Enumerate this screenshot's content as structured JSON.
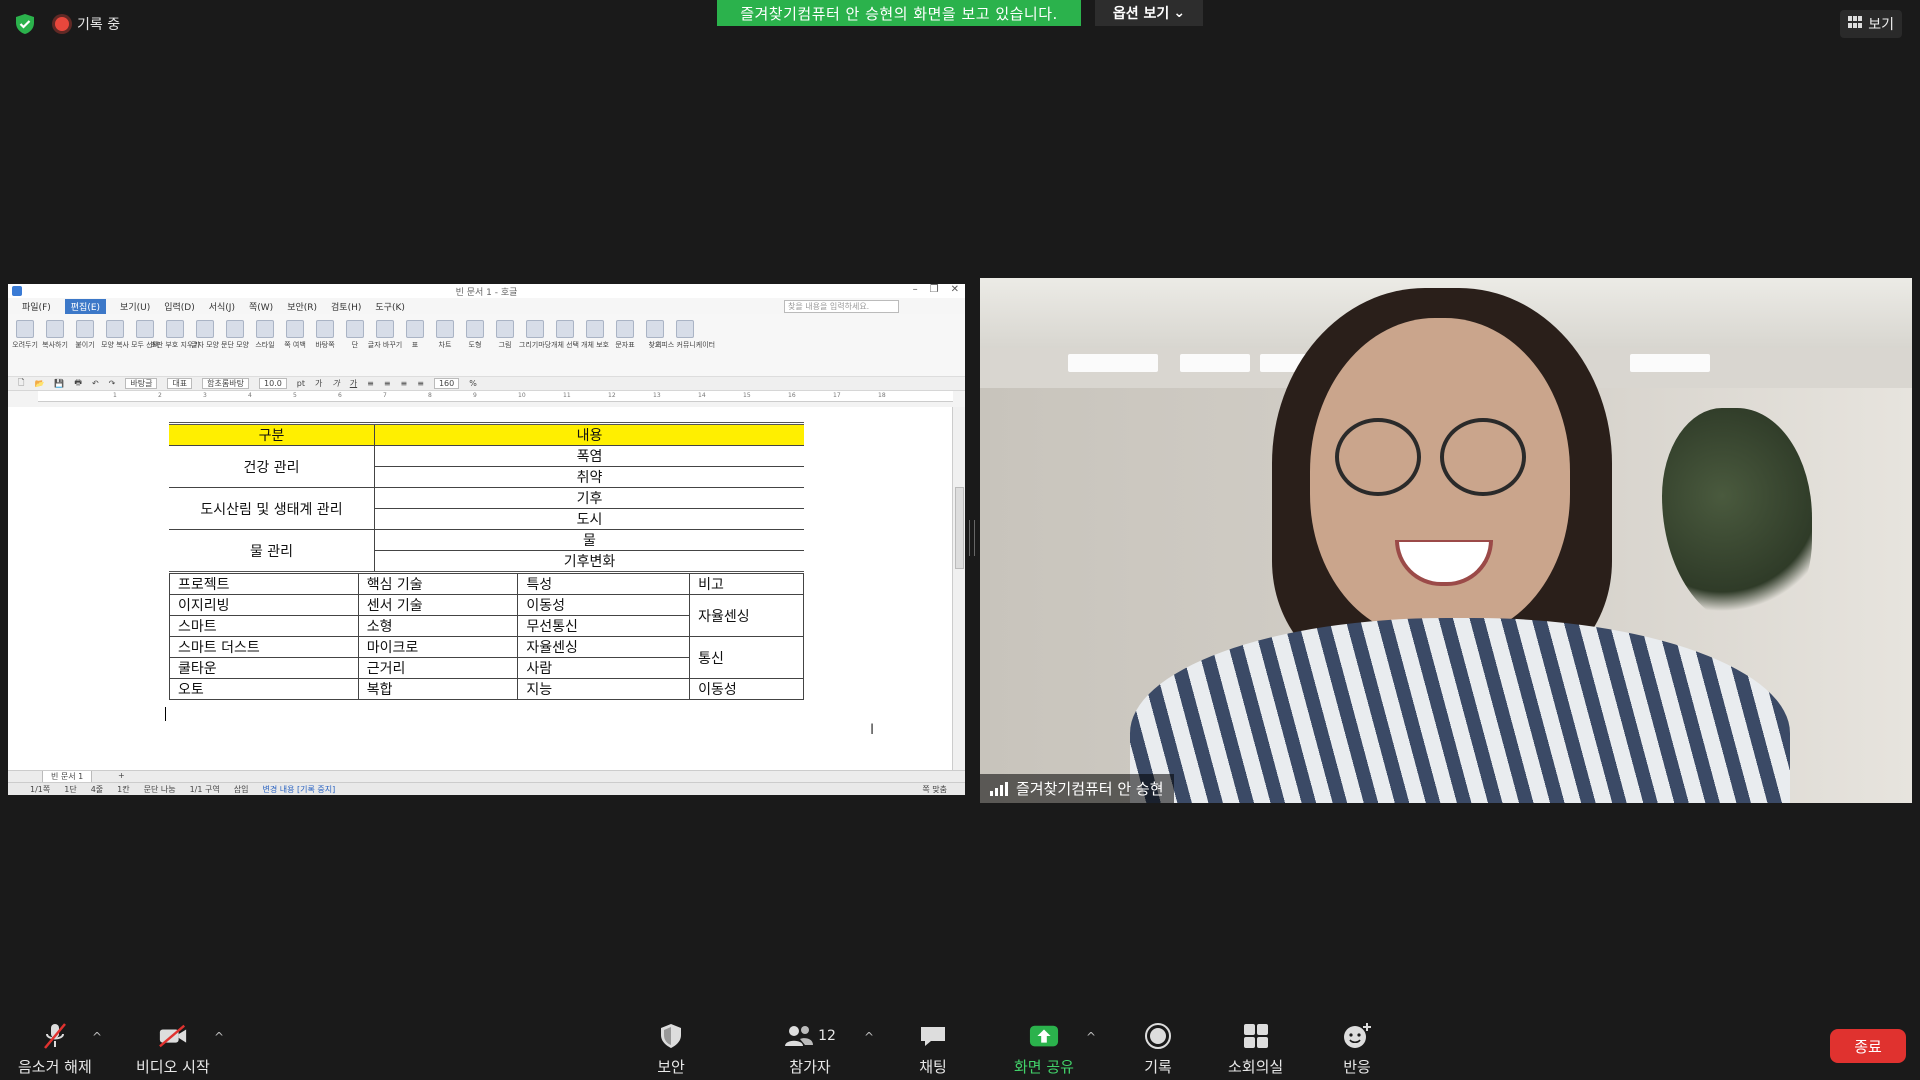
{
  "top_bar": {
    "recording_label": "기록 중",
    "share_banner": "즐겨찾기컴퓨터 안 승현의 화면을 보고 있습니다.",
    "view_options_label": "옵션 보기",
    "view_label": "보기"
  },
  "shared_window": {
    "title": "빈 문서 1 - 호글",
    "menu": [
      "파일(F)",
      "편집(E)",
      "보기(U)",
      "입력(D)",
      "서식(J)",
      "쪽(W)",
      "보안(R)",
      "검토(H)",
      "도구(K)"
    ],
    "search_placeholder": "찾을 내용을 입력하세요.",
    "ribbon": [
      "오려두기",
      "복사하기",
      "붙이기",
      "모양 복사",
      "모두 선택",
      "조판 부호 지우기",
      "글자 모양",
      "문단 모양",
      "스타일",
      "쪽 여백",
      "바탕쪽",
      "단",
      "글자 바꾸기",
      "표",
      "차트",
      "도형",
      "그림",
      "그리기마당",
      "개체 선택",
      "개체 보호",
      "문자표",
      "찾기",
      "오피스 커뮤니케이터"
    ],
    "format": {
      "style": "바탕글",
      "lang": "대표",
      "font": "함초롬바탕",
      "size": "10.0",
      "unit": "pt",
      "zoom": "160",
      "zoom_unit": "%"
    },
    "ruler_marks": [
      "1",
      "2",
      "3",
      "4",
      "5",
      "6",
      "7",
      "8",
      "9",
      "10",
      "11",
      "12",
      "13",
      "14",
      "15",
      "16",
      "17",
      "18"
    ],
    "table1": {
      "header": [
        "구분",
        "내용"
      ],
      "groups": [
        {
          "name": "건강 관리",
          "items": [
            "폭염",
            "취약"
          ]
        },
        {
          "name": "도시산림 및 생태계 관리",
          "items": [
            "기후",
            "도시"
          ]
        },
        {
          "name": "물 관리",
          "items": [
            "물",
            "기후변화"
          ]
        }
      ]
    },
    "table2": {
      "rows": [
        [
          "프로젝트",
          "핵심 기술",
          "특성",
          "비고"
        ],
        [
          "이지리빙",
          "센서 기술",
          "이동성",
          "자율센싱"
        ],
        [
          "스마트",
          "소형",
          "무선통신",
          ""
        ],
        [
          "스마트 더스트",
          "마이크로",
          "자율센싱",
          "통신"
        ],
        [
          "쿨타운",
          "근거리",
          "사람",
          ""
        ],
        [
          "오토",
          "복합",
          "지능",
          "이동성"
        ]
      ]
    },
    "doc_tab": "빈 문서 1",
    "status": [
      "1/1쪽",
      "1단",
      "4줄",
      "1칸",
      "문단 나눔",
      "1/1 구역",
      "삽입"
    ],
    "status_highlight": "변경 내용 [기록 중지]",
    "status_zoom": "쪽 맞춤"
  },
  "video": {
    "participant_name": "즐겨찾기컴퓨터 안 승현"
  },
  "toolbar": {
    "unmute_label": "음소거 해제",
    "video_label": "비디오 시작",
    "security_label": "보안",
    "participants_label": "참가자",
    "participants_count": "12",
    "chat_label": "채팅",
    "share_label": "화면 공유",
    "record_label": "기록",
    "breakout_label": "소회의실",
    "reactions_label": "반응",
    "end_label": "종료"
  },
  "colors": {
    "share_green": "#2bb24c",
    "end_red": "#e0322f",
    "table_header_yellow": "#ffef00"
  }
}
